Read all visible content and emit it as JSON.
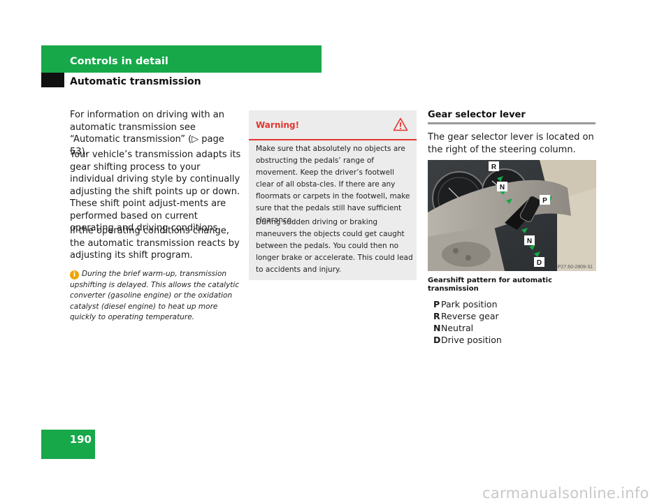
{
  "header": {
    "section": "Controls in detail",
    "subsection": "Automatic transmission"
  },
  "column1": {
    "p1": "For information on driving with an automatic transmission see “Automatic transmission” (▷ page 53).",
    "p2": "Your vehicle’s transmission adapts its gear shifting process to your individual driving style by continually adjusting the shift points up or down. These shift point adjust-ments are performed based on current operating and driving conditions.",
    "p3": "If the operating conditions change, the automatic transmission reacts by adjusting its shift program.",
    "info_icon": "i",
    "info": "During the brief warm-up, transmission upshifting is delayed. This allows the catalytic converter (gasoline engine) or the oxidation catalyst (diesel engine) to heat up more quickly to operating temperature."
  },
  "warning": {
    "title": "Warning!",
    "icon": "warning-triangle-icon",
    "p1": "Make sure that absolutely no objects are obstructing the pedals’ range of movement. Keep the driver’s footwell clear of all obsta-cles. If there are any floormats or carpets in the footwell, make sure that the pedals still have sufficient clearance.",
    "p2": "During sudden driving or braking maneuvers the objects could get caught between the pedals. You could then no longer brake or accelerate. This could lead to accidents and injury."
  },
  "gear_selector": {
    "title": "Gear selector lever",
    "text": "The gear selector lever is located on the right of the steering column.",
    "image_labels": [
      "R",
      "N",
      "P",
      "N",
      "D"
    ],
    "image_code": "P27.60-2809-31",
    "caption": "Gearshift pattern for automatic transmission",
    "legend": [
      {
        "key": "P",
        "label": "Park position"
      },
      {
        "key": "R",
        "label": "Reverse gear"
      },
      {
        "key": "N",
        "label": "Neutral"
      },
      {
        "key": "D",
        "label": "Drive position"
      }
    ]
  },
  "page_number": "190",
  "watermark": "carmanualsonline.info",
  "colors": {
    "brand_green": "#17a84a",
    "warning_red": "#e3342f",
    "info_orange": "#f0a400",
    "warning_bg": "#ececec"
  }
}
